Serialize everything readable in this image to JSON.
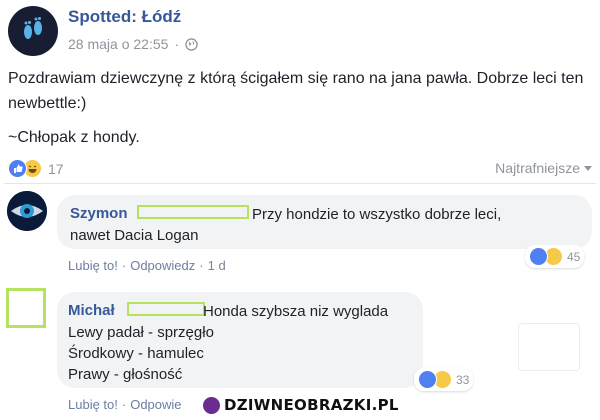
{
  "post": {
    "page_name": "Spotted: Łódź",
    "date": "28 maja o 22:55",
    "separator": "·",
    "avatar_icon": "footprints-icon",
    "paragraphs": [
      "Pozdrawiam dziewczynę z którą ścigałem się rano na jana pawła. Dobrze leci ten newbettle:)",
      "~Chłopak z hondy."
    ],
    "reaction_icons": [
      "like-icon",
      "haha-icon"
    ],
    "reaction_count": "17",
    "sort_label": "Najtrafniejsze"
  },
  "comments": [
    {
      "author": "Szymon",
      "avatar_icon": "eye-icon",
      "lines": [
        "Przy hondzie to wszystko dobrze leci,",
        "nawet Dacia Logan"
      ],
      "like_label": "Lubię to!",
      "reply_label": "Odpowiedz",
      "dot": "·",
      "time": "1 d",
      "reaction_count": "45"
    },
    {
      "author": "Michał",
      "lines": [
        "Honda szybsza niz wyglada",
        "Lewy padał - sprzęgło",
        "Środkowy - hamulec",
        "Prawy - głośność"
      ],
      "like_label": "Lubię to!",
      "reply_label": "Odpowie",
      "dot": "·",
      "reaction_count": "33"
    }
  ],
  "watermark": {
    "text": "DZIWNEOBRAZKI.PL"
  },
  "colors": {
    "link": "#365899",
    "meta": "#90949c",
    "bubble": "#f2f3f5",
    "redact_outline": "#b5e35f",
    "like": "#4f7ff0",
    "haha": "#f7c948"
  }
}
